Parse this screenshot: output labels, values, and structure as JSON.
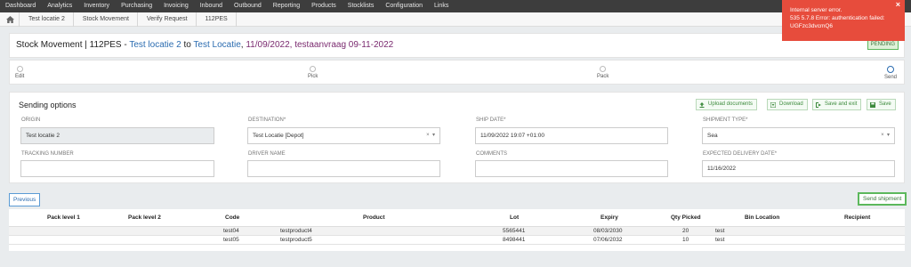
{
  "nav": [
    "Dashboard",
    "Analytics",
    "Inventory",
    "Purchasing",
    "Invoicing",
    "Inbound",
    "Outbound",
    "Reporting",
    "Products",
    "Stocklists",
    "Configuration",
    "Links"
  ],
  "breadcrumb": [
    "Test locatie 2",
    "Stock Movement",
    "Verify Request",
    "112PES"
  ],
  "header": {
    "prefix": "Stock Movement | 112PES",
    "sep": " - ",
    "origin": "Test locatie 2",
    "to": " to ",
    "destination": "Test Locatie",
    "comma": ", ",
    "date": "11/09/2022",
    "description": ", testaanvraag 09-11-2022",
    "status": "PENDING"
  },
  "steps": [
    "Edit",
    "Pick",
    "Pack",
    "Send"
  ],
  "panel": {
    "title": "Sending options",
    "buttons": {
      "upload": "Upload documents",
      "download": "Download",
      "save_exit": "Save and exit",
      "save": "Save"
    },
    "origin_label": "ORIGIN",
    "origin_value": "Test locatie 2",
    "destination_label": "DESTINATION*",
    "destination_value": "Test Locatie [Depot]",
    "ship_date_label": "SHIP DATE*",
    "ship_date_value": "11/09/2022 19:07 +01:00",
    "shipment_type_label": "SHIPMENT TYPE*",
    "shipment_type_value": "Sea",
    "tracking_label": "TRACKING NUMBER",
    "tracking_value": "",
    "driver_label": "DRIVER NAME",
    "driver_value": "",
    "comments_label": "COMMENTS",
    "comments_value": "",
    "expected_label": "EXPECTED DELIVERY DATE*",
    "expected_value": "11/16/2022"
  },
  "actions": {
    "previous": "Previous",
    "send": "Send shipment"
  },
  "table": {
    "headers": {
      "pack1": "Pack level 1",
      "pack2": "Pack level 2",
      "code": "Code",
      "product": "Product",
      "lot": "Lot",
      "expiry": "Expiry",
      "qty": "Qty Picked",
      "bin": "Bin Location",
      "recipient": "Recipient"
    },
    "rows": [
      {
        "code": "test04",
        "product": "testproduct4",
        "lot": "5565441",
        "expiry": "08/03/2030",
        "qty": "20",
        "bin": "test"
      },
      {
        "code": "test05",
        "product": "testproduct5",
        "lot": "8498441",
        "expiry": "07/06/2032",
        "qty": "10",
        "bin": "test"
      }
    ]
  },
  "toast": {
    "line1": "Internal server error.",
    "line2": "535 5.7.8 Error: authentication failed:",
    "line3": "UGFzc3dvcmQ6",
    "close": "×"
  }
}
